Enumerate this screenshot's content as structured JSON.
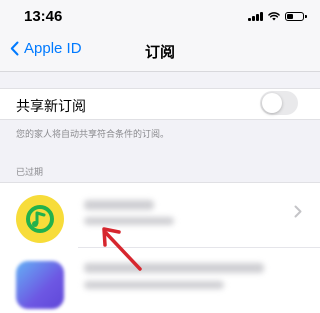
{
  "status_bar": {
    "time": "13:46",
    "icons": [
      "signal-icon",
      "wifi-icon",
      "battery-icon"
    ],
    "battery_level": 0.45
  },
  "nav": {
    "back_label": "Apple ID",
    "title": "订阅"
  },
  "share": {
    "label": "共享新订阅",
    "toggle_on": false,
    "note": "您的家人将自动共享符合条件的订阅。"
  },
  "expired": {
    "header": "已过期"
  },
  "colors": {
    "accent": "#007aff",
    "app_icon_yellow": "#f7dc3a",
    "app_icon_green": "#22b14c",
    "annotation_arrow": "#d6262e"
  }
}
